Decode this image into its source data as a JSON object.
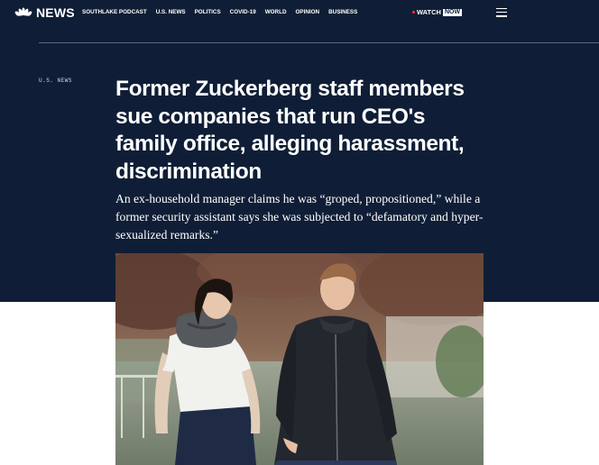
{
  "brand": {
    "logo_text": "NEWS",
    "logo_icon": "peacock-icon"
  },
  "nav": {
    "links": [
      "SOUTHLAKE PODCAST",
      "U.S. NEWS",
      "POLITICS",
      "COVID-19",
      "WORLD",
      "OPINION",
      "BUSINESS"
    ],
    "watch_label": "WATCH",
    "watch_badge": "NOW",
    "menu_icon": "hamburger-menu-icon"
  },
  "article": {
    "section": "U.S. NEWS",
    "headline": "Former Zuckerberg staff members sue companies that run CEO's family office, alleging harassment, discrimination",
    "dek": "An ex-household manager claims he was “groped, propositioned,” while a former security assistant says she was subjected to “defamatory and hyper-sexualized remarks.”"
  },
  "colors": {
    "hero_background": "#0f1e36",
    "live_dot": "#ff3b30"
  }
}
